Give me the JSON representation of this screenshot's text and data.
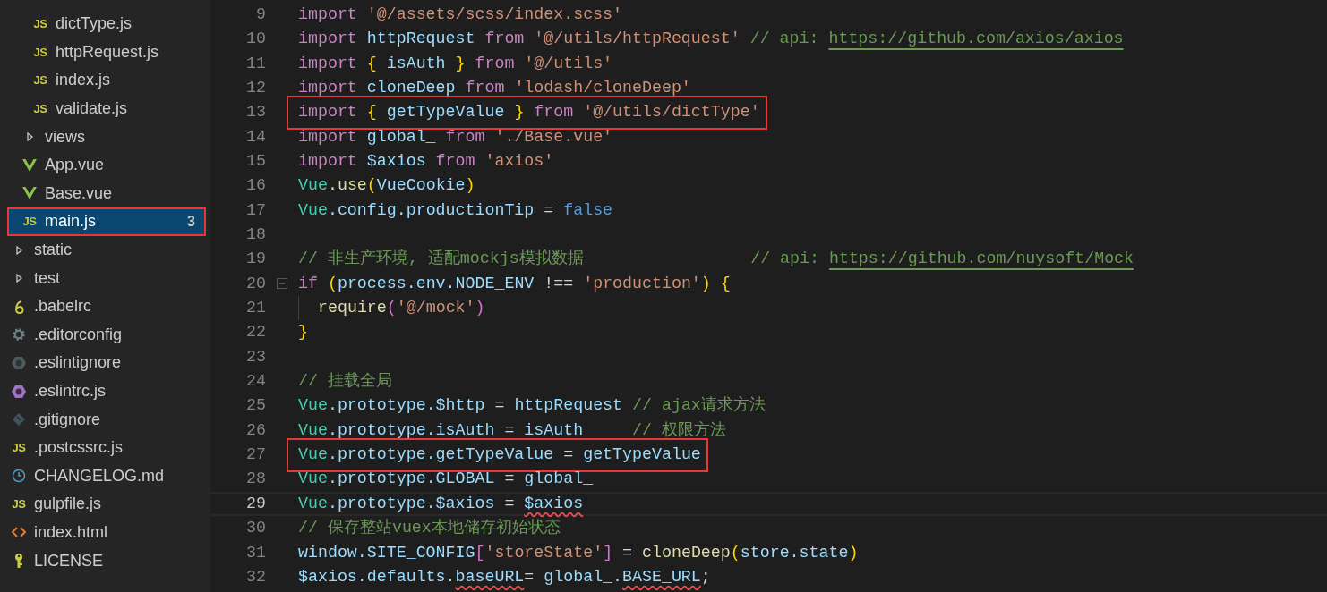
{
  "sidebar": {
    "items": [
      {
        "children": [
          {
            "children": [
              {
                "label": "dictType.js",
                "kind": "js",
                "icon_text": "JS",
                "selected": false
              },
              {
                "label": "httpRequest.js",
                "kind": "js",
                "icon_text": "JS",
                "selected": false
              },
              {
                "label": "index.js",
                "kind": "js",
                "icon_text": "JS",
                "selected": false
              },
              {
                "label": "validate.js",
                "kind": "js",
                "icon_text": "JS",
                "selected": false
              }
            ]
          },
          {
            "label": "views",
            "kind": "folder",
            "expanded": false,
            "selected": false
          },
          {
            "label": "App.vue",
            "kind": "vue",
            "selected": false
          },
          {
            "label": "Base.vue",
            "kind": "vue",
            "selected": false
          },
          {
            "label": "main.js",
            "kind": "js",
            "icon_text": "JS",
            "selected": true,
            "highlighted": true,
            "badge": "3"
          }
        ]
      },
      {
        "label": "static",
        "kind": "folder",
        "expanded": false,
        "selected": false
      },
      {
        "label": "test",
        "kind": "folder",
        "expanded": false,
        "selected": false
      },
      {
        "label": ".babelrc",
        "kind": "babel",
        "selected": false
      },
      {
        "label": ".editorconfig",
        "kind": "gear",
        "selected": false
      },
      {
        "label": ".eslintignore",
        "kind": "eslintignore",
        "selected": false
      },
      {
        "label": ".eslintrc.js",
        "kind": "eslint",
        "selected": false
      },
      {
        "label": ".gitignore",
        "kind": "git",
        "selected": false
      },
      {
        "label": ".postcssrc.js",
        "kind": "js",
        "icon_text": "JS",
        "selected": false
      },
      {
        "label": "CHANGELOG.md",
        "kind": "changelog",
        "selected": false
      },
      {
        "label": "gulpfile.js",
        "kind": "js",
        "icon_text": "JS",
        "selected": false
      },
      {
        "label": "index.html",
        "kind": "html",
        "selected": false
      },
      {
        "label": "LICENSE",
        "kind": "license",
        "selected": false
      }
    ]
  },
  "editor": {
    "lines": [
      {
        "number": "9",
        "tokens": [
          {
            "text": "import ",
            "kind": "keyword"
          },
          {
            "text": "'@/assets/scss/index.scss'",
            "kind": "string"
          }
        ]
      },
      {
        "number": "10",
        "tokens": [
          {
            "text": "import ",
            "kind": "keyword"
          },
          {
            "text": "httpRequest ",
            "kind": "variable"
          },
          {
            "text": "from ",
            "kind": "keyword"
          },
          {
            "text": "'@/utils/httpRequest'",
            "kind": "string"
          },
          {
            "text": " // api: ",
            "kind": "comment"
          },
          {
            "text": "https://github.com/axios/axios",
            "kind": "link"
          }
        ]
      },
      {
        "number": "11",
        "tokens": [
          {
            "text": "import ",
            "kind": "keyword"
          },
          {
            "text": "{ ",
            "kind": "brace"
          },
          {
            "text": "isAuth ",
            "kind": "variable"
          },
          {
            "text": "} ",
            "kind": "brace"
          },
          {
            "text": "from ",
            "kind": "keyword"
          },
          {
            "text": "'@/utils'",
            "kind": "string"
          }
        ]
      },
      {
        "number": "12",
        "tokens": [
          {
            "text": "import ",
            "kind": "keyword"
          },
          {
            "text": "cloneDeep ",
            "kind": "variable"
          },
          {
            "text": "from ",
            "kind": "keyword"
          },
          {
            "text": "'lodash/cloneDeep'",
            "kind": "string"
          }
        ]
      },
      {
        "number": "13",
        "highlighted": true,
        "tokens": [
          {
            "text": "import ",
            "kind": "keyword"
          },
          {
            "text": "{ ",
            "kind": "brace"
          },
          {
            "text": "getTypeValue ",
            "kind": "variable"
          },
          {
            "text": "} ",
            "kind": "brace"
          },
          {
            "text": "from ",
            "kind": "keyword"
          },
          {
            "text": "'@/utils/dictType'",
            "kind": "string"
          }
        ]
      },
      {
        "number": "14",
        "tokens": [
          {
            "text": "import ",
            "kind": "keyword"
          },
          {
            "text": "global_ ",
            "kind": "variable"
          },
          {
            "text": "from ",
            "kind": "keyword"
          },
          {
            "text": "'./Base.vue'",
            "kind": "string"
          }
        ]
      },
      {
        "number": "15",
        "tokens": [
          {
            "text": "import ",
            "kind": "keyword"
          },
          {
            "text": "$axios ",
            "kind": "variable"
          },
          {
            "text": "from ",
            "kind": "keyword"
          },
          {
            "text": "'axios'",
            "kind": "string"
          }
        ]
      },
      {
        "number": "16",
        "tokens": [
          {
            "text": "Vue",
            "kind": "class"
          },
          {
            "text": ".",
            "kind": "operator"
          },
          {
            "text": "use",
            "kind": "function"
          },
          {
            "text": "(",
            "kind": "brace"
          },
          {
            "text": "VueCookie",
            "kind": "variable"
          },
          {
            "text": ")",
            "kind": "brace"
          }
        ]
      },
      {
        "number": "17",
        "tokens": [
          {
            "text": "Vue",
            "kind": "class"
          },
          {
            "text": ".config.productionTip",
            "kind": "variable"
          },
          {
            "text": " = ",
            "kind": "operator"
          },
          {
            "text": "false",
            "kind": "literal"
          }
        ]
      },
      {
        "number": "18"
      },
      {
        "number": "19",
        "tokens": [
          {
            "text": "// 非生产环境, 适配mockjs模拟数据                 // api: ",
            "kind": "comment"
          },
          {
            "text": "https://github.com/nuysoft/Mock",
            "kind": "link"
          }
        ]
      },
      {
        "number": "20",
        "foldable": true,
        "tokens": [
          {
            "text": "if ",
            "kind": "keyword"
          },
          {
            "text": "(",
            "kind": "brace"
          },
          {
            "text": "process.env.NODE_ENV",
            "kind": "variable"
          },
          {
            "text": " !== ",
            "kind": "operator"
          },
          {
            "text": "'production'",
            "kind": "string"
          },
          {
            "text": ") {",
            "kind": "brace"
          }
        ]
      },
      {
        "number": "21",
        "indent_guide": true,
        "tokens": [
          {
            "text": "require",
            "kind": "function"
          },
          {
            "text": "(",
            "kind": "paren"
          },
          {
            "text": "'@/mock'",
            "kind": "string"
          },
          {
            "text": ")",
            "kind": "paren"
          }
        ]
      },
      {
        "number": "22",
        "tokens": [
          {
            "text": "}",
            "kind": "brace"
          }
        ]
      },
      {
        "number": "23"
      },
      {
        "number": "24",
        "tokens": [
          {
            "text": "// 挂载全局",
            "kind": "comment"
          }
        ]
      },
      {
        "number": "25",
        "tokens": [
          {
            "text": "Vue",
            "kind": "class"
          },
          {
            "text": ".prototype.$http",
            "kind": "variable"
          },
          {
            "text": " = ",
            "kind": "operator"
          },
          {
            "text": "httpRequest",
            "kind": "variable"
          },
          {
            "text": " // ajax请求方法",
            "kind": "comment"
          }
        ]
      },
      {
        "number": "26",
        "tokens": [
          {
            "text": "Vue",
            "kind": "class"
          },
          {
            "text": ".prototype.isAuth",
            "kind": "variable"
          },
          {
            "text": " = ",
            "kind": "operator"
          },
          {
            "text": "isAuth",
            "kind": "variable"
          },
          {
            "text": "     // 权限方法",
            "kind": "comment"
          }
        ]
      },
      {
        "number": "27",
        "highlighted": true,
        "tokens": [
          {
            "text": "Vue",
            "kind": "class"
          },
          {
            "text": ".prototype.getTypeValue",
            "kind": "variable"
          },
          {
            "text": " = ",
            "kind": "operator"
          },
          {
            "text": "getTypeValue",
            "kind": "variable"
          }
        ]
      },
      {
        "number": "28",
        "tokens": [
          {
            "text": "Vue",
            "kind": "class"
          },
          {
            "text": ".prototype.GLOBAL",
            "kind": "variable"
          },
          {
            "text": " = ",
            "kind": "operator"
          },
          {
            "text": "global_",
            "kind": "variable"
          }
        ]
      },
      {
        "number": "29",
        "current": true,
        "tokens": [
          {
            "text": "Vue",
            "kind": "class"
          },
          {
            "text": ".prototype.$axios",
            "kind": "variable"
          },
          {
            "text": " = ",
            "kind": "operator"
          },
          {
            "text": "$axios",
            "kind": "variable",
            "error": true
          }
        ]
      },
      {
        "number": "30",
        "tokens": [
          {
            "text": "// 保存整站vuex本地储存初始状态",
            "kind": "comment"
          }
        ]
      },
      {
        "number": "31",
        "tokens": [
          {
            "text": "window.SITE_CONFIG",
            "kind": "variable"
          },
          {
            "text": "[",
            "kind": "paren"
          },
          {
            "text": "'storeState'",
            "kind": "string"
          },
          {
            "text": "]",
            "kind": "paren"
          },
          {
            "text": " = ",
            "kind": "operator"
          },
          {
            "text": "cloneDeep",
            "kind": "function"
          },
          {
            "text": "(",
            "kind": "brace"
          },
          {
            "text": "store.state",
            "kind": "variable"
          },
          {
            "text": ")",
            "kind": "brace"
          }
        ]
      },
      {
        "number": "32",
        "tokens": [
          {
            "text": "$axios.defaults.",
            "kind": "variable"
          },
          {
            "text": "baseURL",
            "kind": "variable",
            "error": true
          },
          {
            "text": "= ",
            "kind": "operator"
          },
          {
            "text": "global_.",
            "kind": "variable"
          },
          {
            "text": "BASE_URL",
            "kind": "variable",
            "error": true
          },
          {
            "text": ";",
            "kind": "operator"
          }
        ]
      }
    ]
  }
}
